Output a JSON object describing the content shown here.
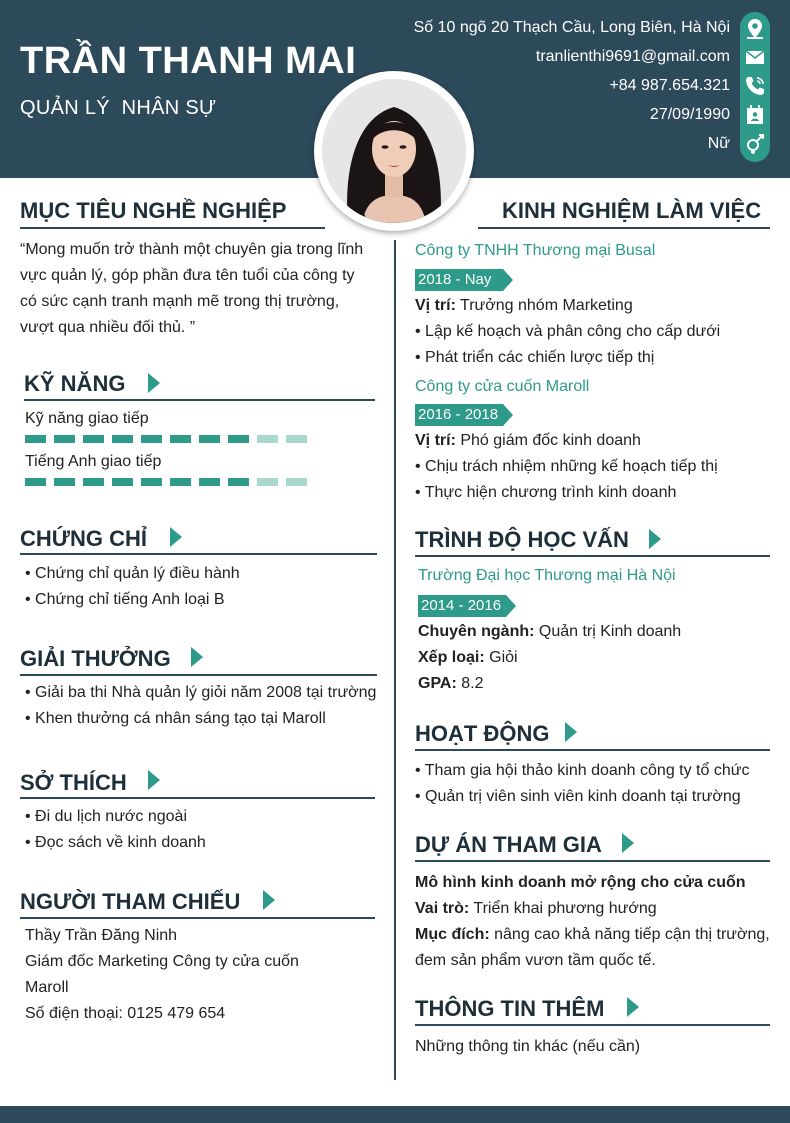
{
  "header": {
    "name": "TRẦN THANH MAI",
    "role": "QUẢN LÝ  NHÂN SỰ",
    "contacts": [
      {
        "icon": "location-icon",
        "text": "Số 10 ngõ 20 Thạch Cầu, Long Biên, Hà Nội"
      },
      {
        "icon": "mail-icon",
        "text": "tranlienthi9691@gmail.com"
      },
      {
        "icon": "phone-icon",
        "text": "+84 987.654.321"
      },
      {
        "icon": "calendar-icon",
        "text": "27/09/1990"
      },
      {
        "icon": "gender-icon",
        "text": "Nữ"
      }
    ]
  },
  "objective": {
    "title": "MỤC TIÊU NGHỀ NGHIỆP",
    "text": "“Mong muốn trở thành một chuyên gia trong lĩnh vực quản lý, góp phần đưa tên tuổi của công ty có sức cạnh tranh mạnh mẽ trong thị trường, vượt qua nhiều đối thủ. ”"
  },
  "skills": {
    "title": "KỸ NĂNG",
    "items": [
      {
        "label": "Kỹ năng giao tiếp",
        "level": 8,
        "max": 10
      },
      {
        "label": "Tiếng Anh giao tiếp",
        "level": 8,
        "max": 10
      }
    ]
  },
  "certificates": {
    "title": "CHỨNG CHỈ",
    "items": [
      "• Chứng chỉ quản lý điều hành",
      "• Chứng chỉ tiếng Anh loại B"
    ]
  },
  "awards": {
    "title": "GIẢI THƯỞNG",
    "items": [
      "• Giải ba thi Nhà quản lý giỏi năm 2008 tại trường",
      "• Khen thưởng cá nhân sáng tạo tại Maroll"
    ]
  },
  "hobbies": {
    "title": "SỞ THÍCH",
    "items": [
      "• Đi du lịch nước ngoài",
      "• Đọc sách về kinh doanh"
    ]
  },
  "references": {
    "title": "NGƯỜI THAM CHIẾU",
    "name": "Thầy Trần Đăng Ninh",
    "position_line1": "Giám đốc Marketing Công ty cửa cuốn",
    "position_line2": "Maroll",
    "phone_label": "Số điện thoại:",
    "phone": " 0125 479 654"
  },
  "experience": {
    "title": "KINH NGHIỆM LÀM VIỆC",
    "jobs": [
      {
        "company": "Công ty TNHH Thương mại Busal",
        "period": "2018 - Nay",
        "position_label": "Vị trí:",
        "position": " Trưởng nhóm Marketing",
        "bullets": [
          "• Lập kế hoạch và phân công cho cấp dưới",
          "• Phát triển các chiến lược tiếp thị"
        ]
      },
      {
        "company": "Công ty cửa cuốn Maroll",
        "period": "2016 - 2018",
        "position_label": "Vị trí:",
        "position": " Phó giám đốc kinh doanh",
        "bullets": [
          "• Chịu trách nhiệm những kế hoạch tiếp thị",
          "• Thực hiện chương trình kinh doanh"
        ]
      }
    ]
  },
  "education": {
    "title": "TRÌNH ĐỘ HỌC VẤN",
    "school": "Trường Đại học Thương mại Hà Nội",
    "period": "2014 - 2016",
    "major_label": "Chuyên ngành:",
    "major": " Quản trị Kinh doanh",
    "rank_label": "Xếp loại:",
    "rank": " Giỏi",
    "gpa_label": "GPA:",
    "gpa": " 8.2"
  },
  "activities": {
    "title": "HOẠT ĐỘNG",
    "items": [
      "• Tham gia hội thảo kinh doanh công ty tổ chức",
      "• Quản trị viên sinh viên kinh doanh tại trường"
    ]
  },
  "projects": {
    "title": "DỰ ÁN THAM GIA",
    "name": "Mô hình kinh doanh mở rộng cho cửa cuốn",
    "role_label": "Vai trò:",
    "role": " Triển khai phương hướng",
    "goal_label": "Mục đích:",
    "goal_line1": " nâng cao khả năng tiếp cận thị trường,",
    "goal_line2": "đem sản phẩm vươn tầm quốc tế."
  },
  "extra": {
    "title": "THÔNG TIN THÊM",
    "text": "Những thông tin khác (nếu cần)"
  },
  "colors": {
    "primary": "#2d4a5b",
    "accent": "#2e9a8a",
    "accent_light": "#a9d8cf"
  }
}
